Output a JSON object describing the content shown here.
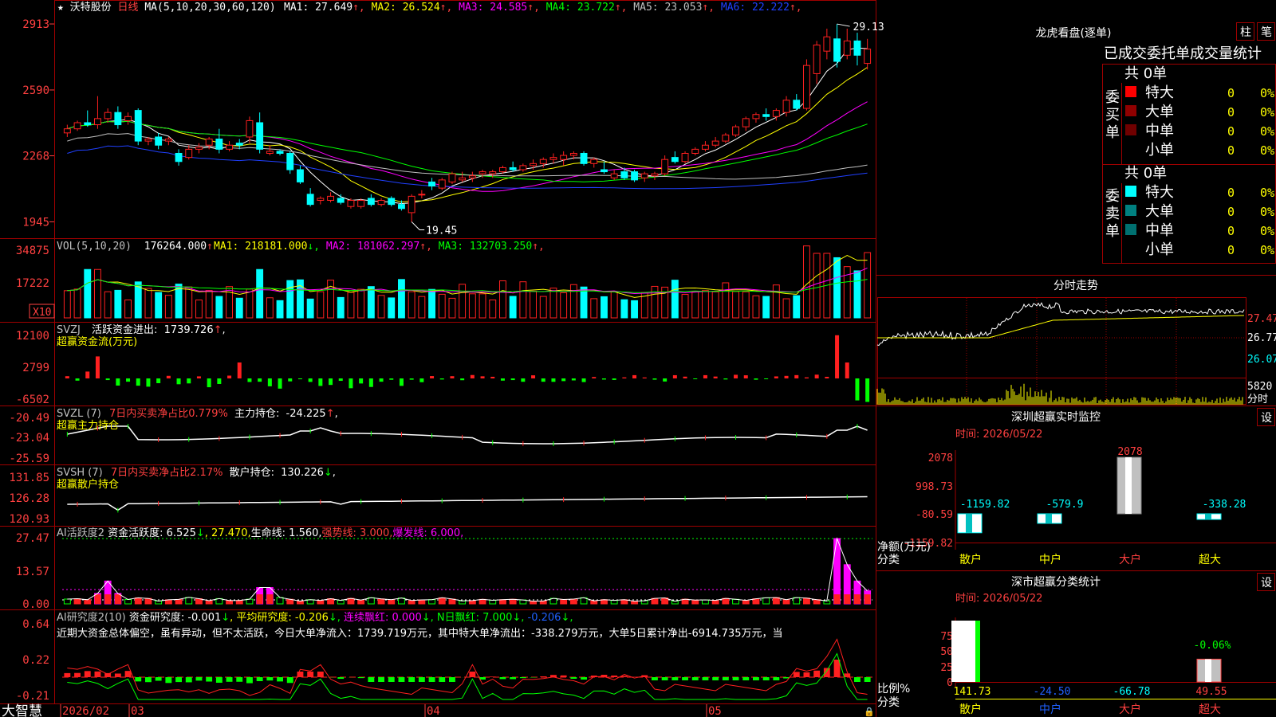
{
  "header": {
    "star": "★",
    "stock_name": "沃特股份",
    "period": "日线",
    "ma_label": "MA(5,10,20,30,60,120)",
    "ma_values": [
      {
        "name": "MA1:",
        "value": "27.649",
        "dir": "↑",
        "color": "#ffffff"
      },
      {
        "name": "MA2:",
        "value": "26.524",
        "dir": "↑",
        "color": "#ffff00"
      },
      {
        "name": "MA3:",
        "value": "24.585",
        "dir": "↑",
        "color": "#ff00ff"
      },
      {
        "name": "MA4:",
        "value": "23.722",
        "dir": "↑",
        "color": "#00ff00"
      },
      {
        "name": "MA5:",
        "value": "23.053",
        "dir": "↑",
        "color": "#c0c0c0"
      },
      {
        "name": "MA6:",
        "value": "22.222",
        "dir": "↑",
        "color": "#2040ff"
      }
    ]
  },
  "colors": {
    "up": "#ff2020",
    "down": "#00ffff",
    "grid": "#a00000",
    "axis": "#ff4040"
  },
  "price_panel": {
    "ticks": [
      "2913",
      "2590",
      "2268",
      "1945"
    ],
    "tick_values": [
      29.13,
      25.9,
      22.68,
      19.45
    ],
    "high_label": "29.13",
    "low_label": "19.45"
  },
  "vol_panel": {
    "title": "VOL(5,10,20)",
    "value": "176264.000",
    "value_dir": "↑",
    "ma": [
      {
        "name": "MA1:",
        "value": "218181.000",
        "dir": "↓",
        "color": "#ffff00"
      },
      {
        "name": "MA2:",
        "value": "181062.297",
        "dir": "↑",
        "color": "#ff00ff"
      },
      {
        "name": "MA3:",
        "value": "132703.250",
        "dir": "↑",
        "color": "#00ff00"
      }
    ],
    "ticks": [
      "34875",
      "17222"
    ],
    "unit": "X10"
  },
  "svzj_panel": {
    "title": "SVZJ",
    "label": "活跃资金进出:",
    "value": "1739.726",
    "dir": "↑",
    "subtitle": "超赢资金流(万元)",
    "ticks": [
      "12100",
      "2799",
      "-6502"
    ]
  },
  "svzl_panel": {
    "title": "SVZL (7)",
    "label1": "7日内买卖净占比0.779%",
    "label2": "主力持仓:",
    "value": "-24.225",
    "dir": "↑",
    "subtitle": "超赢主力持仓",
    "ticks": [
      "-20.49",
      "-23.04",
      "-25.59"
    ]
  },
  "svsh_panel": {
    "title": "SVSH (7)",
    "label1": "7日内买卖净占比2.17%",
    "label2": "散户持仓:",
    "value": "130.226",
    "dir": "↓",
    "subtitle": "超赢散户持仓",
    "ticks": [
      "131.85",
      "126.28",
      "120.93"
    ]
  },
  "ai_active_panel": {
    "title": "AI活跃度2",
    "items": [
      {
        "text": "资金活跃度: 6.525",
        "color": "#ffffff"
      },
      {
        "text": "↓",
        "color": "#00ff00"
      },
      {
        "text": ", 27.470,",
        "color": "#ffff00"
      },
      {
        "text": "生命线: 1.560,",
        "color": "#ffffff"
      },
      {
        "text": "强势线: 3.000,",
        "color": "#ff4040"
      },
      {
        "text": "爆发线: 6.000,",
        "color": "#ff00ff"
      }
    ],
    "ticks": [
      "27.47",
      "13.57",
      "0.00"
    ]
  },
  "ai_research_panel": {
    "title": "AI研究度2(10)",
    "items": [
      {
        "text": "资金研究度: -0.001",
        "color": "#ffffff"
      },
      {
        "text": "↓",
        "color": "#00ff00"
      },
      {
        "text": ", 平均研究度: -0.206",
        "color": "#ffff00"
      },
      {
        "text": "↓,",
        "color": "#00ff00"
      },
      {
        "text": " 连续飘红: 0.000",
        "color": "#ff00ff"
      },
      {
        "text": "↓,",
        "color": "#00ff00"
      },
      {
        "text": " N日飘红: 7.000",
        "color": "#00ff00"
      },
      {
        "text": "↓,",
        "color": "#00ff00"
      },
      {
        "text": " -0.206",
        "color": "#2060ff"
      },
      {
        "text": "↓,",
        "color": "#00ff00"
      }
    ],
    "commentary": "近期大资金总体偏空，虽有异动，但不太活跃，今日大单净流入：1739.719万元，其中特大单净流出：-338.279万元，大单5日累计净出-6914.735万元，当",
    "ticks": [
      "0.64",
      "0.22",
      "-0.21"
    ]
  },
  "bottom": {
    "brand": "大智慧",
    "dates": [
      "2026/02",
      "03",
      "04",
      "05"
    ]
  },
  "longhu": {
    "title": "龙虎看盘(逐单)",
    "btn_bar": "柱",
    "btn_pen": "笔",
    "tabs": [
      "已成交",
      "委托单",
      "成交量",
      "统计"
    ],
    "buy": {
      "side_label": "委买单",
      "total": "共 0单",
      "rows": [
        {
          "color": "#ff0000",
          "name": "特大",
          "count": "0",
          "pct": "0%"
        },
        {
          "color": "#900000",
          "name": "大单",
          "count": "0",
          "pct": "0%"
        },
        {
          "color": "#700000",
          "name": "中单",
          "count": "0",
          "pct": "0%"
        },
        {
          "color": "",
          "name": "小单",
          "count": "0",
          "pct": "0%"
        }
      ]
    },
    "sell": {
      "side_label": "委卖单",
      "total": "共 0单",
      "rows": [
        {
          "color": "#00ffff",
          "name": "特大",
          "count": "0",
          "pct": "0%"
        },
        {
          "color": "#008080",
          "name": "大单",
          "count": "0",
          "pct": "0%"
        },
        {
          "color": "#007070",
          "name": "中单",
          "count": "0",
          "pct": "0%"
        },
        {
          "color": "",
          "name": "小单",
          "count": "0",
          "pct": "0%"
        }
      ]
    }
  },
  "intraday": {
    "title": "分时走势",
    "price_ticks": [
      "27.47",
      "26.77",
      "26.07"
    ],
    "vol_tick": "5820",
    "vol_unit": "分时"
  },
  "monitor": {
    "title": "深圳超赢实时监控",
    "btn": "设",
    "time": "时间: 2026/05/22",
    "ylabel": "净额(万元)",
    "xlabel": "分类",
    "ticks": [
      "2078",
      "998.73",
      "-80.59",
      "-1159.82"
    ]
  },
  "classify": {
    "title": "深市超赢分类统计",
    "btn": "设",
    "time": "时间: 2026/05/22",
    "ylabel": "比例%",
    "xlabel": "分类",
    "ticks": [
      "75",
      "50",
      "25",
      "0"
    ]
  },
  "chart_data": [
    {
      "type": "bar",
      "title": "深圳超赢实时监控",
      "ylabel": "净额(万元)",
      "xlabel": "分类",
      "categories": [
        "散户",
        "中户",
        "大户",
        "超大"
      ],
      "values": [
        -1159.82,
        -579.9,
        2078,
        -338.28
      ],
      "value_labels": [
        "-1159.82",
        "-579.9",
        "2078",
        "-338.28"
      ],
      "ylim": [
        -1159.82,
        2078
      ]
    },
    {
      "type": "bar",
      "title": "深市超赢分类统计",
      "ylabel": "比例%",
      "xlabel": "分类",
      "categories": [
        "散户",
        "中户",
        "大户",
        "超大"
      ],
      "values": [
        141.73,
        -24.5,
        -66.78,
        49.55
      ],
      "value_labels": [
        "141.73",
        "-24.50",
        "-66.78",
        "49.55"
      ],
      "top_label": "-0.06%",
      "ylim": [
        0,
        75
      ]
    },
    {
      "type": "candlestick",
      "title": "沃特股份 日线",
      "ylim": [
        19.0,
        29.6
      ],
      "ohlc": [
        [
          23.8,
          24.2,
          23.6,
          24.0
        ],
        [
          24.0,
          24.4,
          23.9,
          24.3
        ],
        [
          24.3,
          24.9,
          24.1,
          24.2
        ],
        [
          24.2,
          25.6,
          24.0,
          24.5
        ],
        [
          24.5,
          25.0,
          24.3,
          24.8
        ],
        [
          24.8,
          25.1,
          24.0,
          24.2
        ],
        [
          24.4,
          24.8,
          24.2,
          24.6
        ],
        [
          24.9,
          25.0,
          23.2,
          23.4
        ],
        [
          23.4,
          23.6,
          23.2,
          23.5
        ],
        [
          23.6,
          23.8,
          23.0,
          23.2
        ],
        [
          23.4,
          23.6,
          23.2,
          23.5
        ],
        [
          22.8,
          23.0,
          22.2,
          22.4
        ],
        [
          22.6,
          23.2,
          22.5,
          23.0
        ],
        [
          23.0,
          23.3,
          22.8,
          23.1
        ],
        [
          23.2,
          23.6,
          23.0,
          23.5
        ],
        [
          23.5,
          24.0,
          22.8,
          23.0
        ],
        [
          23.0,
          23.4,
          22.9,
          23.2
        ],
        [
          23.3,
          23.5,
          23.0,
          23.2
        ],
        [
          23.6,
          24.6,
          23.3,
          24.4
        ],
        [
          24.3,
          24.8,
          22.8,
          23.0
        ],
        [
          22.8,
          23.2,
          22.7,
          22.9
        ],
        [
          22.9,
          23.0,
          22.7,
          22.8
        ],
        [
          22.8,
          22.9,
          21.8,
          22.0
        ],
        [
          22.0,
          22.2,
          21.3,
          21.4
        ],
        [
          20.8,
          21.1,
          20.2,
          20.3
        ],
        [
          20.5,
          20.7,
          20.3,
          20.6
        ],
        [
          20.5,
          20.9,
          20.4,
          20.7
        ],
        [
          20.6,
          20.8,
          20.3,
          20.4
        ],
        [
          20.2,
          20.6,
          20.1,
          20.5
        ],
        [
          20.2,
          20.6,
          20.1,
          20.5
        ],
        [
          20.6,
          20.8,
          20.2,
          20.3
        ],
        [
          20.3,
          20.6,
          20.2,
          20.5
        ],
        [
          20.6,
          20.7,
          20.2,
          20.3
        ],
        [
          20.3,
          20.5,
          20.0,
          20.1
        ],
        [
          19.9,
          20.8,
          19.45,
          20.7
        ],
        [
          20.8,
          21.0,
          20.6,
          20.8
        ],
        [
          21.4,
          21.6,
          21.0,
          21.2
        ],
        [
          21.1,
          21.6,
          21.0,
          21.5
        ],
        [
          21.4,
          21.9,
          21.3,
          21.8
        ],
        [
          21.5,
          21.9,
          21.4,
          21.6
        ],
        [
          21.6,
          21.9,
          21.4,
          21.7
        ],
        [
          21.8,
          22.0,
          21.6,
          21.9
        ],
        [
          21.8,
          22.0,
          21.6,
          21.9
        ],
        [
          21.9,
          22.2,
          21.8,
          22.1
        ],
        [
          22.1,
          22.4,
          21.9,
          22.0
        ],
        [
          22.0,
          22.3,
          21.9,
          22.2
        ],
        [
          22.2,
          22.5,
          22.0,
          22.3
        ],
        [
          22.3,
          22.6,
          22.1,
          22.5
        ],
        [
          22.5,
          22.8,
          22.3,
          22.6
        ],
        [
          22.5,
          22.9,
          22.2,
          22.7
        ],
        [
          22.7,
          22.9,
          22.5,
          22.8
        ],
        [
          22.8,
          22.9,
          22.2,
          22.3
        ],
        [
          22.3,
          22.6,
          22.1,
          22.5
        ],
        [
          22.0,
          22.4,
          21.8,
          21.9
        ],
        [
          21.6,
          22.0,
          21.5,
          21.8
        ],
        [
          21.9,
          22.1,
          21.5,
          21.6
        ],
        [
          21.9,
          22.0,
          21.4,
          21.5
        ],
        [
          21.6,
          21.9,
          21.4,
          21.8
        ],
        [
          21.7,
          21.9,
          21.5,
          21.8
        ],
        [
          21.8,
          22.7,
          21.7,
          22.5
        ],
        [
          22.6,
          22.9,
          22.3,
          22.4
        ],
        [
          22.4,
          22.9,
          22.3,
          22.8
        ],
        [
          22.8,
          23.1,
          22.7,
          23.0
        ],
        [
          23.0,
          23.4,
          22.9,
          23.2
        ],
        [
          23.2,
          23.6,
          23.1,
          23.4
        ],
        [
          23.4,
          23.8,
          23.3,
          23.7
        ],
        [
          23.7,
          24.2,
          23.6,
          24.1
        ],
        [
          24.1,
          24.6,
          23.9,
          24.5
        ],
        [
          24.5,
          24.8,
          24.3,
          24.7
        ],
        [
          24.7,
          25.0,
          24.4,
          24.6
        ],
        [
          24.6,
          25.0,
          24.4,
          24.9
        ],
        [
          24.8,
          25.6,
          24.6,
          25.4
        ],
        [
          25.4,
          25.7,
          24.9,
          25.0
        ],
        [
          25.0,
          27.4,
          24.9,
          27.1
        ],
        [
          26.7,
          28.3,
          26.2,
          28.1
        ],
        [
          27.8,
          28.9,
          27.4,
          28.5
        ],
        [
          28.4,
          29.13,
          27.0,
          27.3
        ],
        [
          27.6,
          28.9,
          27.4,
          28.3
        ],
        [
          28.3,
          28.7,
          27.1,
          27.6
        ],
        [
          27.2,
          28.4,
          26.9,
          27.9
        ]
      ]
    }
  ]
}
